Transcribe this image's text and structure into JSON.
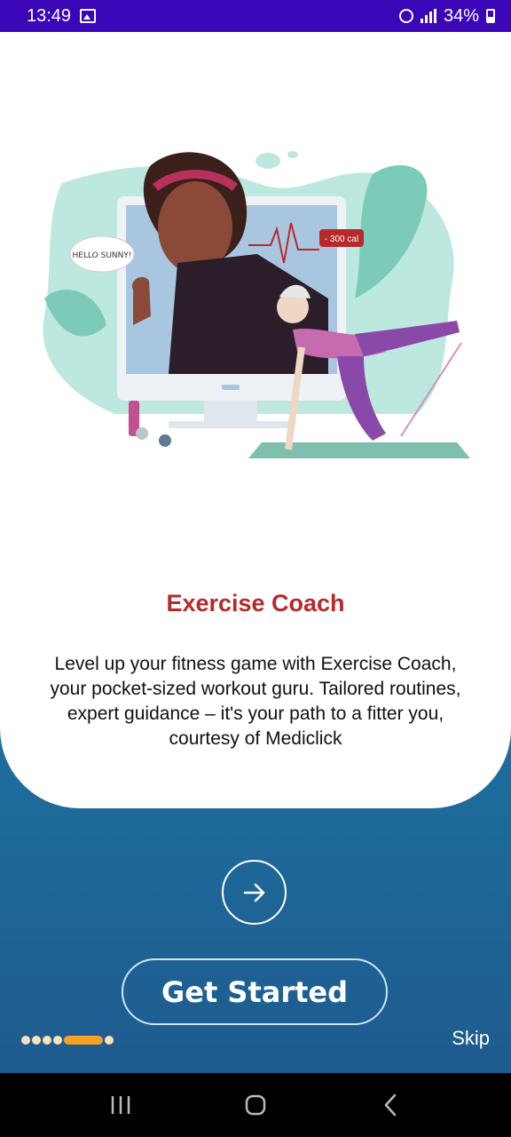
{
  "status_bar": {
    "time": "13:49",
    "battery": "34%",
    "icons": [
      "image-icon",
      "alarm-icon",
      "signal-icon",
      "battery-icon"
    ]
  },
  "illustration": {
    "speech_bubble": "HELLO SUNNY!",
    "calorie_tag": "- 300 cal"
  },
  "onboarding": {
    "title": "Exercise Coach",
    "description": "Level up your fitness game with Exercise Coach, your pocket-sized workout guru. Tailored routines, expert guidance – it's your path to a fitter you, courtesy of Mediclick",
    "page_index": 5,
    "page_count": 7
  },
  "actions": {
    "next_icon": "arrow-right-icon",
    "get_started": "Get Started",
    "skip": "Skip"
  },
  "nav_bar": {
    "icons": [
      "recent-apps-icon",
      "home-icon",
      "back-icon"
    ]
  },
  "colors": {
    "status_bar": "#3a06b8",
    "title": "#b8292a",
    "indicator_active": "#f6a224",
    "indicator_inactive": "#fbe2b8",
    "gradient_top": "#1d9fb8",
    "gradient_bottom": "#1e5b8f"
  }
}
